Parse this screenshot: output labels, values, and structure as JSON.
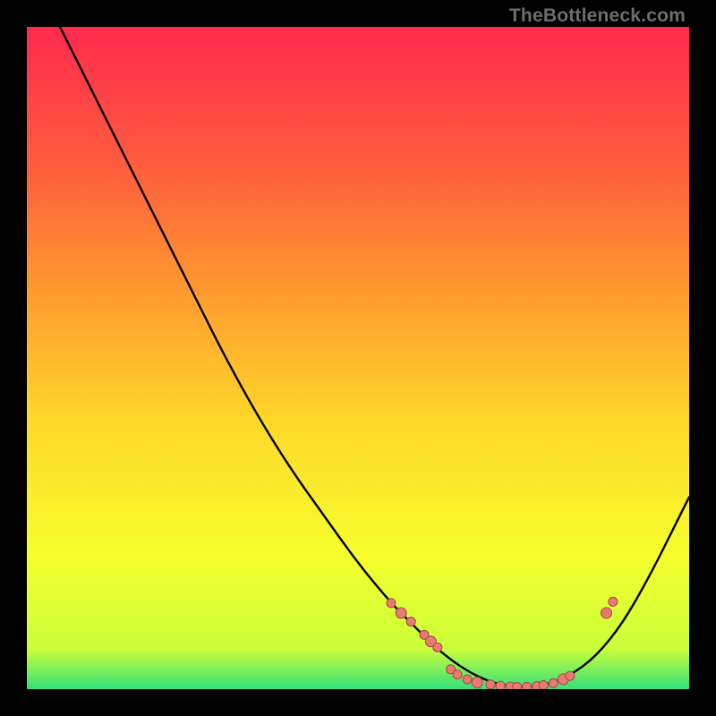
{
  "watermark": "TheBottleneck.com",
  "chart_data": {
    "type": "line",
    "title": "",
    "xlabel": "",
    "ylabel": "",
    "xlim": [
      0,
      100
    ],
    "ylim": [
      0,
      100
    ],
    "grid": false,
    "legend": false,
    "background_gradient": {
      "stops": [
        {
          "offset": 0,
          "color": "#ff2a4d"
        },
        {
          "offset": 20,
          "color": "#ff5a3e"
        },
        {
          "offset": 40,
          "color": "#ff9a2f"
        },
        {
          "offset": 60,
          "color": "#ffd92a"
        },
        {
          "offset": 80,
          "color": "#f6ff2c"
        },
        {
          "offset": 94,
          "color": "#c9ff3a"
        },
        {
          "offset": 100,
          "color": "#34e07a"
        }
      ]
    },
    "series": [
      {
        "name": "curve",
        "x": [
          5,
          10,
          15,
          20,
          25,
          30,
          35,
          40,
          45,
          50,
          55,
          58,
          62,
          66,
          70,
          74,
          78,
          82,
          86,
          90,
          94,
          98,
          100
        ],
        "y": [
          100,
          90,
          80,
          70,
          60,
          50,
          41,
          33,
          26,
          19,
          13,
          10,
          6,
          3,
          1,
          0.3,
          0.5,
          2,
          5,
          10,
          17,
          25,
          29
        ],
        "stroke": "#000000",
        "stroke_width": 2.4
      }
    ],
    "markers": {
      "name": "points",
      "fill": "#e97a72",
      "stroke": "#a84f49",
      "stroke_width": 1.1,
      "r_default": 5,
      "points": [
        {
          "x": 55,
          "y": 13,
          "r": 5
        },
        {
          "x": 56.5,
          "y": 11.5,
          "r": 6
        },
        {
          "x": 58,
          "y": 10.2,
          "r": 5
        },
        {
          "x": 60,
          "y": 8.2,
          "r": 5
        },
        {
          "x": 61,
          "y": 7.2,
          "r": 6
        },
        {
          "x": 62,
          "y": 6.3,
          "r": 5
        },
        {
          "x": 64,
          "y": 3.0,
          "r": 5
        },
        {
          "x": 65,
          "y": 2.2,
          "r": 5
        },
        {
          "x": 66.5,
          "y": 1.5,
          "r": 5
        },
        {
          "x": 68,
          "y": 1.0,
          "r": 6
        },
        {
          "x": 70,
          "y": 0.7,
          "r": 5
        },
        {
          "x": 71.5,
          "y": 0.5,
          "r": 5
        },
        {
          "x": 73,
          "y": 0.4,
          "r": 5
        },
        {
          "x": 74,
          "y": 0.35,
          "r": 5
        },
        {
          "x": 75.5,
          "y": 0.35,
          "r": 5
        },
        {
          "x": 77,
          "y": 0.45,
          "r": 5
        },
        {
          "x": 78,
          "y": 0.6,
          "r": 5
        },
        {
          "x": 79.5,
          "y": 0.9,
          "r": 5
        },
        {
          "x": 81,
          "y": 1.5,
          "r": 6
        },
        {
          "x": 82,
          "y": 2.0,
          "r": 5
        },
        {
          "x": 87.5,
          "y": 11.5,
          "r": 6
        },
        {
          "x": 88.5,
          "y": 13.2,
          "r": 5
        }
      ]
    }
  }
}
